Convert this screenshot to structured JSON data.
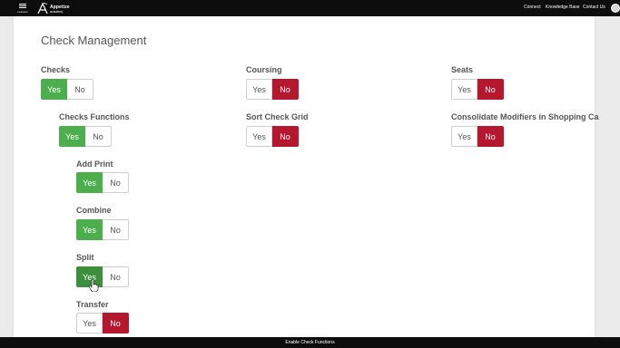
{
  "header": {
    "menu_label": "Lessons",
    "logo_name": "Appetize",
    "logo_sub": "academy",
    "nav": [
      "Connect",
      "Knowledge Base",
      "Contact Us"
    ]
  },
  "page": {
    "title": "Check Management"
  },
  "yes_label": "Yes",
  "no_label": "No",
  "settings": [
    {
      "label": "Checks",
      "value": "Yes"
    },
    {
      "label": "Checks Functions",
      "value": "Yes"
    },
    {
      "label": "Add Print",
      "value": "Yes"
    },
    {
      "label": "Combine",
      "value": "Yes"
    },
    {
      "label": "Split",
      "value": "Yes"
    },
    {
      "label": "Transfer",
      "value": "No"
    },
    {
      "label": "Coursing",
      "value": "No"
    },
    {
      "label": "Sort Check Grid",
      "value": "No"
    },
    {
      "label": "Seats",
      "value": "No"
    },
    {
      "label": "Consolidate Modifiers in Shopping Ca",
      "value": "No"
    }
  ],
  "footer": {
    "caption": "Enable Check Functions"
  },
  "colors": {
    "yes_active": "#4cae4c",
    "no_active": "#b5172f",
    "bar": "#0d0d0d"
  }
}
